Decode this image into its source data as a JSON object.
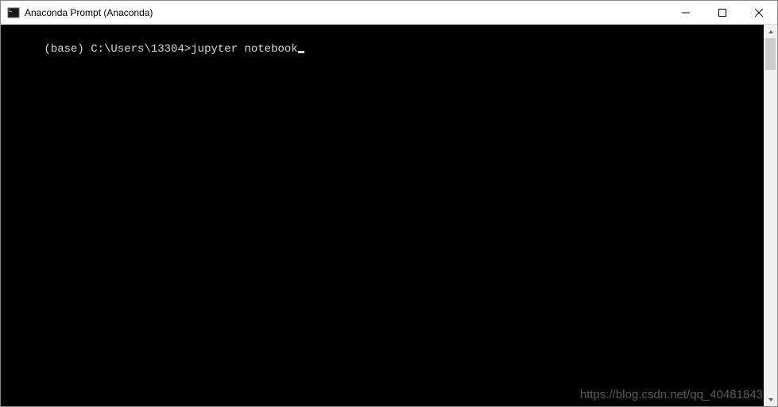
{
  "window": {
    "title": "Anaconda Prompt (Anaconda)"
  },
  "terminal": {
    "prompt": "(base) C:\\Users\\13304>",
    "command": "jupyter notebook"
  },
  "watermark": "https://blog.csdn.net/qq_40481843"
}
